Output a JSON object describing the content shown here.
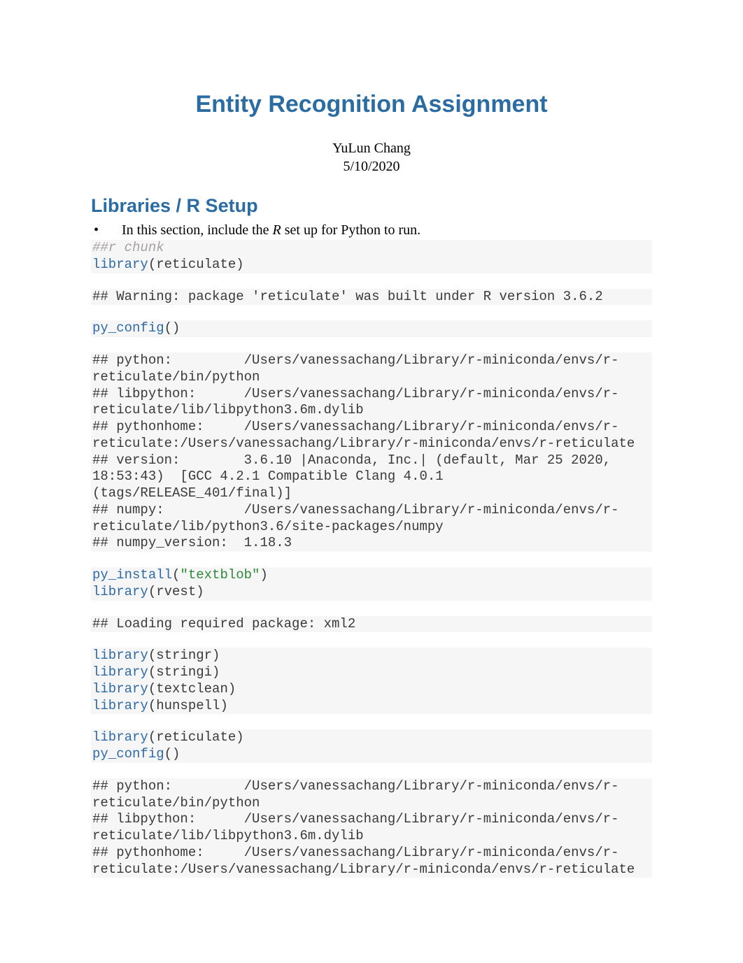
{
  "title": "Entity Recognition Assignment",
  "author": "YuLun Chang",
  "date": "5/10/2020",
  "section1": {
    "heading": "Libraries / R Setup",
    "bullet_prefix": "In this section, include the ",
    "bullet_italic": "R",
    "bullet_suffix": " set up for Python to run."
  },
  "code": {
    "c1_comment": "##r chunk",
    "c1_l1_fn": "library",
    "c1_l1_arg": "(reticulate)",
    "c2": "## Warning: package 'reticulate' was built under R version 3.6.2",
    "c3_fn": "py_config",
    "c3_arg": "()",
    "c4": "## python:         /Users/vanessachang/Library/r-miniconda/envs/r-reticulate/bin/python\n## libpython:      /Users/vanessachang/Library/r-miniconda/envs/r-reticulate/lib/libpython3.6m.dylib\n## pythonhome:     /Users/vanessachang/Library/r-miniconda/envs/r-reticulate:/Users/vanessachang/Library/r-miniconda/envs/r-reticulate\n## version:        3.6.10 |Anaconda, Inc.| (default, Mar 25 2020, 18:53:43)  [GCC 4.2.1 Compatible Clang 4.0.1 (tags/RELEASE_401/final)]\n## numpy:          /Users/vanessachang/Library/r-miniconda/envs/r-reticulate/lib/python3.6/site-packages/numpy\n## numpy_version:  1.18.3",
    "c5_l1_fn": "py_install",
    "c5_l1_p1": "(",
    "c5_l1_str": "\"textblob\"",
    "c5_l1_p2": ")",
    "c5_l2_fn": "library",
    "c5_l2_arg": "(rvest)",
    "c6": "## Loading required package: xml2",
    "c7_l1_fn": "library",
    "c7_l1_arg": "(stringr)",
    "c7_l2_fn": "library",
    "c7_l2_arg": "(stringi)",
    "c7_l3_fn": "library",
    "c7_l3_arg": "(textclean)",
    "c7_l4_fn": "library",
    "c7_l4_arg": "(hunspell)",
    "c8_l1_fn": "library",
    "c8_l1_arg": "(reticulate)",
    "c8_l2_fn": "py_config",
    "c8_l2_arg": "()",
    "c9": "## python:         /Users/vanessachang/Library/r-miniconda/envs/r-reticulate/bin/python\n## libpython:      /Users/vanessachang/Library/r-miniconda/envs/r-reticulate/lib/libpython3.6m.dylib\n## pythonhome:     /Users/vanessachang/Library/r-miniconda/envs/r-reticulate:/Users/vanessachang/Library/r-miniconda/envs/r-reticulate"
  }
}
